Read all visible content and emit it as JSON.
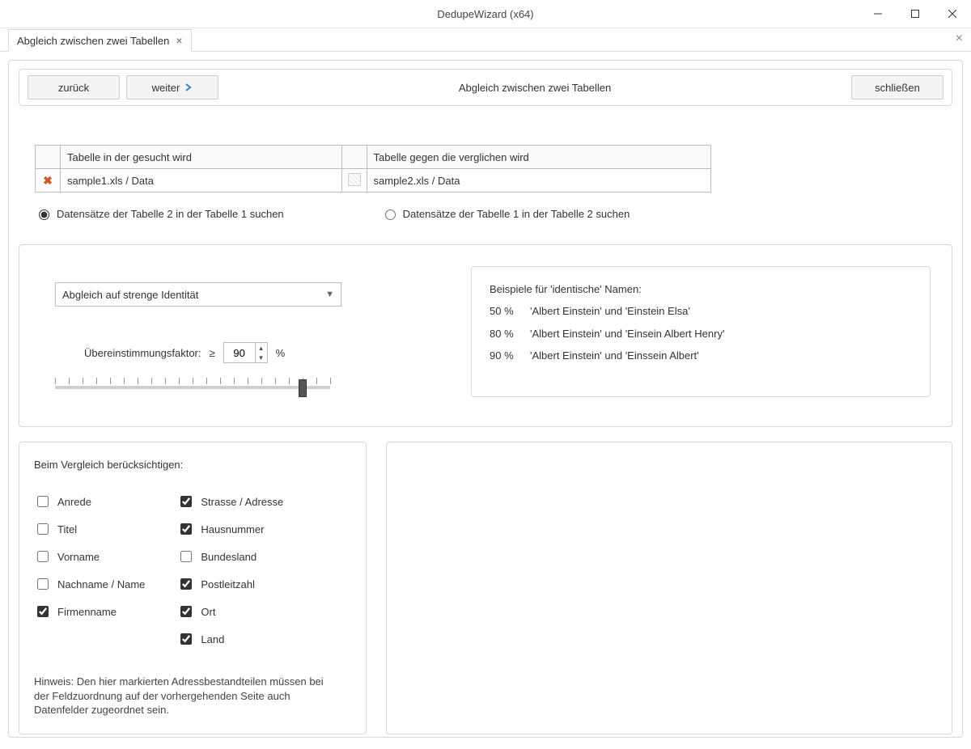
{
  "window": {
    "title": "DedupeWizard  (x64)"
  },
  "tab": {
    "label": "Abgleich zwischen zwei Tabellen"
  },
  "toolbar": {
    "back": "zurück",
    "next": "weiter",
    "title": "Abgleich zwischen zwei Tabellen",
    "close": "schließen"
  },
  "grid": {
    "headers": {
      "left": "Tabelle in der gesucht wird",
      "right": "Tabelle gegen die verglichen wird"
    },
    "row": {
      "file1": "sample1.xls / Data",
      "file2": "sample2.xls / Data"
    }
  },
  "radios": {
    "opt1": "Datensätze der Tabelle 2 in der Tabelle 1 suchen",
    "opt2": "Datensätze der Tabelle 1 in der Tabelle 2 suchen"
  },
  "match": {
    "method": "Abgleich auf strenge Identität",
    "factor_label": "Übereinstimmungsfaktor:",
    "factor_op": "≥",
    "factor_value": "90",
    "factor_unit": "%",
    "slider_percent": 90
  },
  "examples": {
    "title": "Beispiele für 'identische' Namen:",
    "rows": [
      {
        "pct": "50 %",
        "text": "'Albert Einstein' und 'Einstein Elsa'"
      },
      {
        "pct": "80 %",
        "text": "'Albert Einstein' und 'Einsein Albert Henry'"
      },
      {
        "pct": "90 %",
        "text": "'Albert Einstein' und 'Einssein Albert'"
      }
    ]
  },
  "fields": {
    "heading": "Beim Vergleich berücksichtigen:",
    "left": [
      {
        "label": "Anrede",
        "checked": false
      },
      {
        "label": "Titel",
        "checked": false
      },
      {
        "label": "Vorname",
        "checked": false
      },
      {
        "label": "Nachname / Name",
        "checked": false
      },
      {
        "label": "Firmenname",
        "checked": true
      }
    ],
    "right": [
      {
        "label": "Strasse / Adresse",
        "checked": true
      },
      {
        "label": "Hausnummer",
        "checked": true
      },
      {
        "label": "Bundesland",
        "checked": false
      },
      {
        "label": "Postleitzahl",
        "checked": true
      },
      {
        "label": "Ort",
        "checked": true
      },
      {
        "label": "Land",
        "checked": true
      }
    ],
    "hint": "Hinweis: Den hier markierten Adressbestandteilen müssen bei der Feldzuordnung auf der vorhergehenden Seite auch Datenfelder zugeordnet sein."
  }
}
